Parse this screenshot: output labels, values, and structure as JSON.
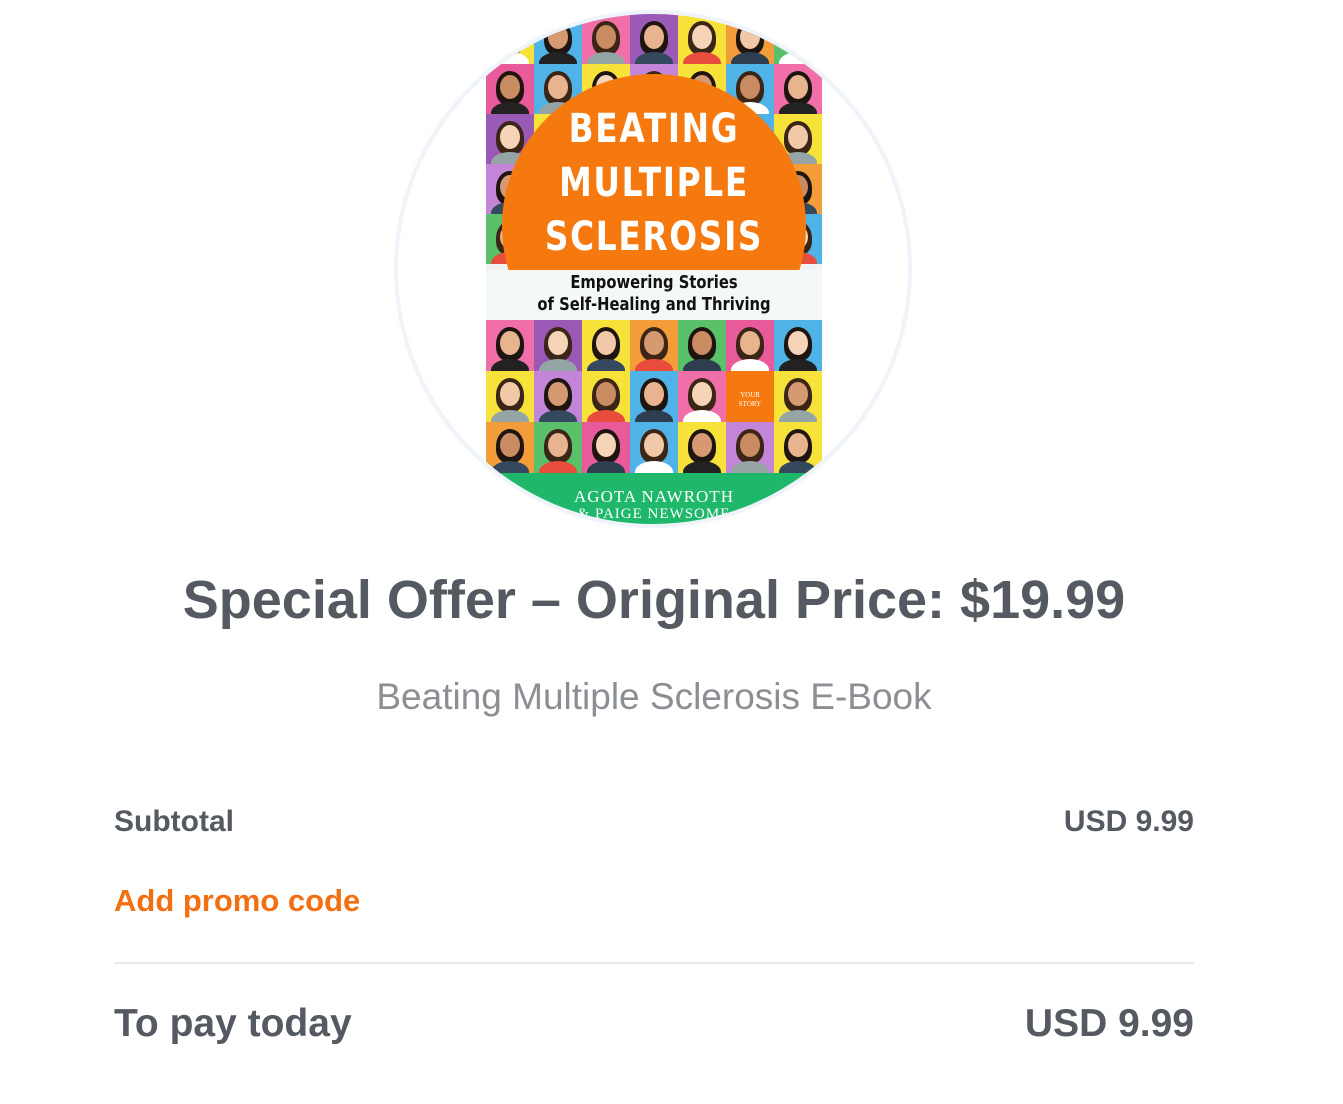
{
  "product": {
    "cover": {
      "title_lines": [
        "BEATING",
        "MULTIPLE",
        "SCLEROSIS"
      ],
      "subtitle_lines": [
        "Empowering Stories",
        "of Self-Healing and Thriving"
      ],
      "badge_lines": [
        "YOUR",
        "STORY"
      ],
      "author_1": "AGOTA NAWROTH",
      "author_2": "& PAIGE NEWSOME"
    }
  },
  "offer": {
    "title": "Special Offer – Original Price: $19.99",
    "product_name": "Beating Multiple Sclerosis E-Book"
  },
  "summary": {
    "subtotal_label": "Subtotal",
    "subtotal_value": "USD 9.99",
    "promo_label": "Add promo code",
    "total_label": "To pay today",
    "total_value": "USD 9.99"
  },
  "colors": {
    "accent": "#f37012",
    "text": "#555a62",
    "muted": "#8b8f94",
    "cover_orange": "#f6790f",
    "cover_green": "#1fb86a"
  }
}
